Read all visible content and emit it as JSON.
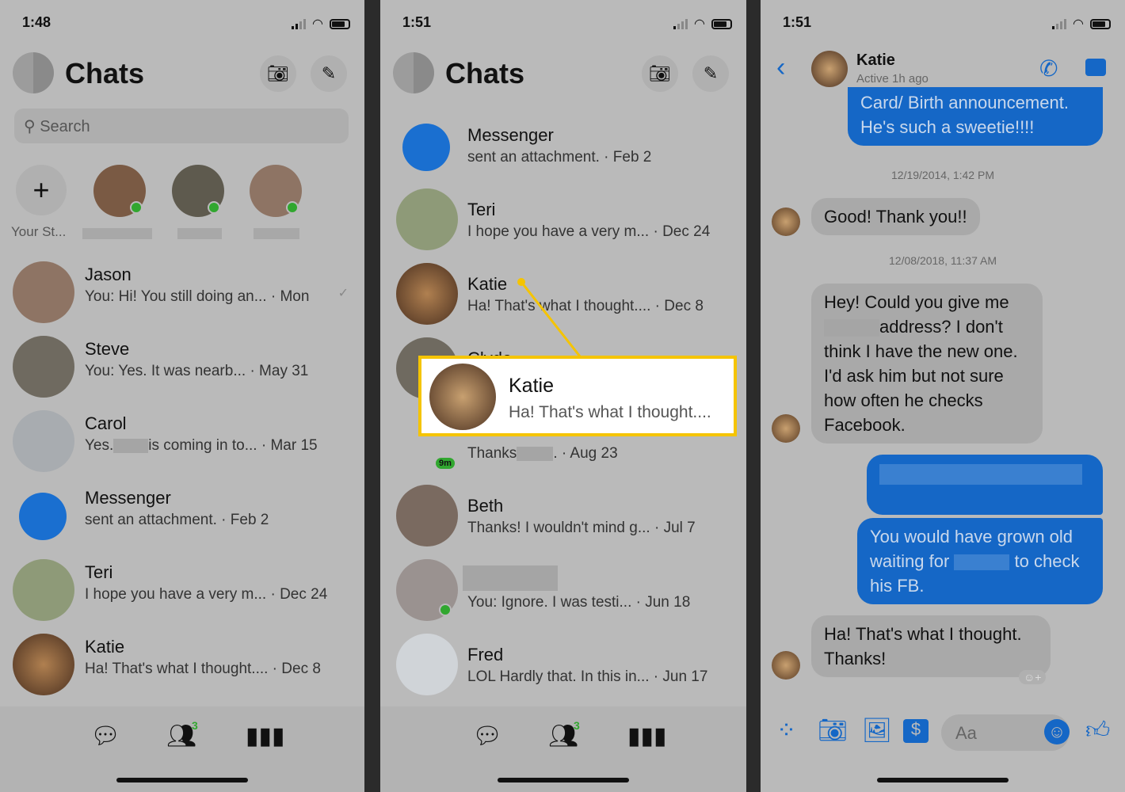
{
  "panel1": {
    "time": "1:48",
    "title": "Chats",
    "search_placeholder": "Search",
    "your_story": "Your St...",
    "chats": [
      {
        "name": "Jason",
        "preview": "You: Hi! You still doing an... · Mon"
      },
      {
        "name": "Steve",
        "preview": "You: Yes. It was nearb...  · May 31"
      },
      {
        "name": "Carol",
        "preview_a": "Yes.",
        "preview_b": "is coming in to...  · Mar 15"
      },
      {
        "name": "Messenger",
        "preview": " sent an attachment. · Feb 2"
      },
      {
        "name": "Teri",
        "preview": "I hope you have a very m... · Dec 24"
      },
      {
        "name": "Katie",
        "preview": "Ha! That's what I thought.... · Dec 8"
      }
    ],
    "people_badge": "3"
  },
  "panel2": {
    "time": "1:51",
    "title": "Chats",
    "chats": [
      {
        "name": "Messenger",
        "preview": " sent an attachment. · Feb 2"
      },
      {
        "name": "Teri",
        "preview": "I hope you have a very m... · Dec 24"
      },
      {
        "name": "Katie",
        "preview": "Ha! That's what I thought.... · Dec 8"
      },
      {
        "name": "Clyde",
        "preview_a": "Thanks",
        "preview_b": ". · Aug 23",
        "badge": "9m"
      },
      {
        "name": "Beth",
        "preview": "Thanks!  I wouldn't mind g...  · Jul 7"
      },
      {
        "name": "",
        "preview": "You: Ignore. I was testi...  · Jun 18"
      },
      {
        "name": "Fred",
        "preview": "LOL Hardly that. In this in... · Jun 17"
      }
    ],
    "highlight": {
      "name": "Katie",
      "preview": "Ha! That's what I thought....",
      "color": "#f5c400"
    },
    "people_badge": "3"
  },
  "panel3": {
    "time": "1:51",
    "contact": "Katie",
    "status": "Active 1h ago",
    "messages": [
      {
        "from": "me",
        "text": "Card/ Birth announcement. He's such a sweetie!!!!"
      },
      {
        "timestamp": "12/19/2014, 1:42 PM"
      },
      {
        "from": "them",
        "text": "Good! Thank you!!"
      },
      {
        "timestamp": "12/08/2018, 11:37 AM"
      },
      {
        "from": "them",
        "text_a": "Hey! Could you give me",
        "text_b": "address? I don't think I have the new one. I'd ask him but not sure how often he checks Facebook."
      },
      {
        "from": "me",
        "text_a": "You would have grown old waiting for",
        "text_b": "to check his FB."
      },
      {
        "from": "them",
        "text": "Ha! That's what I thought. Thanks!"
      }
    ],
    "composer_placeholder": "Aa",
    "accent": "#1567c6"
  }
}
